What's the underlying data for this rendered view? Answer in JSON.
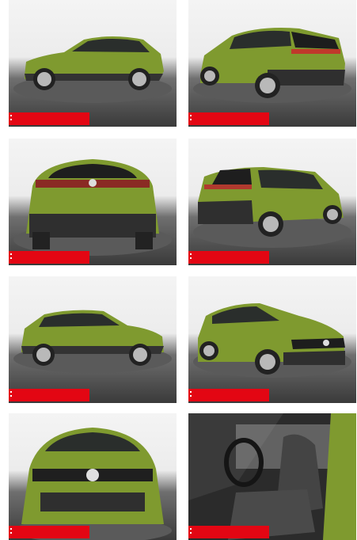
{
  "gallery": {
    "colors": {
      "car_body": "#7f9a2f",
      "car_shadow": "#5e7420",
      "glass": "#2a2e2c",
      "floor": "#4a4a4a",
      "backdrop": "#efefef",
      "badge": "#e30613"
    },
    "photos": [
      {
        "view": "side-left"
      },
      {
        "view": "rear-three-quarter-left"
      },
      {
        "view": "rear"
      },
      {
        "view": "rear-three-quarter-right"
      },
      {
        "view": "side-right"
      },
      {
        "view": "front-three-quarter-right"
      },
      {
        "view": "front"
      },
      {
        "view": "interior-front-seats"
      }
    ]
  }
}
